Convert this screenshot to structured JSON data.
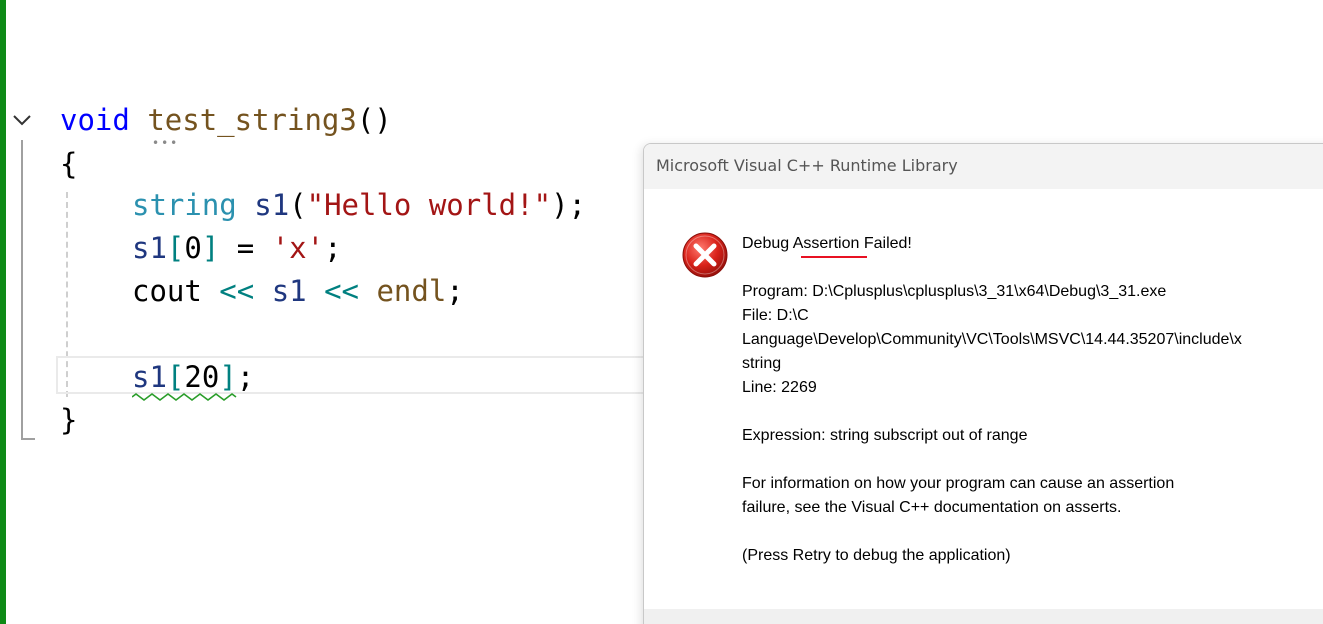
{
  "editor": {
    "line1": {
      "kw": "void",
      "fn": "test_string3",
      "rest": "()"
    },
    "line2": "{",
    "line3": {
      "type": "string",
      "ident": "s1",
      "open": "(",
      "str": "\"Hello world!\"",
      "close": ");"
    },
    "line4": {
      "ident": "s1",
      "b1": "[",
      "num": "0",
      "b2": "]",
      "eq": " = ",
      "str": "'x'",
      "semi": ";"
    },
    "line5": {
      "ident": "cout",
      "op1": " << ",
      "ident2": "s1",
      "op2": " << ",
      "endl": "endl",
      "semi": ";"
    },
    "line7": {
      "ident": "s1",
      "b1": "[",
      "num": "20",
      "b2": "]",
      "semi": ";"
    },
    "line8": "}",
    "hint_dots": "•••"
  },
  "dialog": {
    "title": "Microsoft Visual C++ Runtime Library",
    "heading": "Debug Assertion Failed!",
    "program": "Program: D:\\Cplusplus\\cplusplus\\3_31\\x64\\Debug\\3_31.exe",
    "file1": "File: D:\\C",
    "file2": "Language\\Develop\\Community\\VC\\Tools\\MSVC\\14.44.35207\\include\\x",
    "file3": "string",
    "line": "Line: 2269",
    "expression": "Expression: string subscript out of range",
    "info1": "For information on how your program can cause an assertion",
    "info2": "failure, see the Visual C++ documentation on asserts.",
    "retry": "(Press Retry to debug the application)",
    "icon": "error-icon"
  },
  "colors": {
    "change_bar": "#0e8a16",
    "keyword": "#0000ff",
    "function": "#74531f",
    "type": "#2b91af",
    "identifier": "#1f377f",
    "string": "#a31515",
    "operator": "#008080",
    "error_red": "#e81123"
  }
}
